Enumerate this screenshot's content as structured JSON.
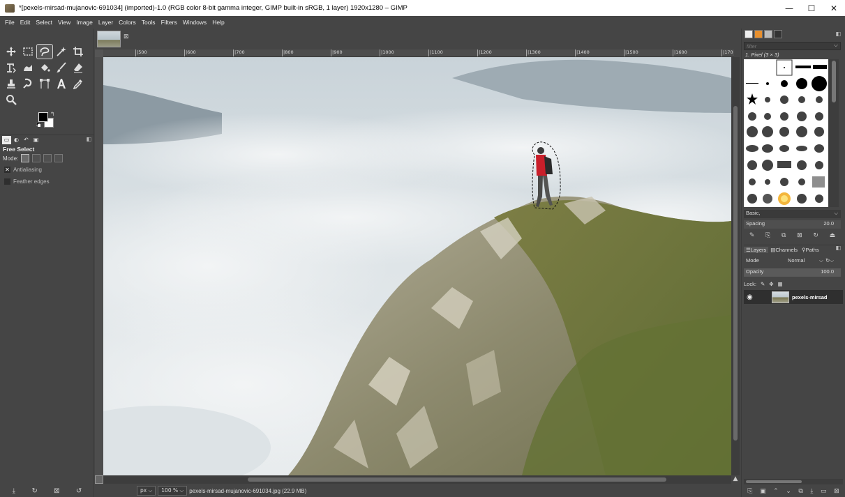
{
  "window": {
    "title": "*[pexels-mirsad-mujanovic-691034] (imported)-1.0 (RGB color 8-bit gamma integer, GIMP built-in sRGB, 1 layer) 1920x1280 – GIMP",
    "minimize": "—",
    "maximize": "☐",
    "close": "✕"
  },
  "menu": [
    "File",
    "Edit",
    "Select",
    "View",
    "Image",
    "Layer",
    "Colors",
    "Tools",
    "Filters",
    "Windows",
    "Help"
  ],
  "tool_options": {
    "title": "Free Select",
    "mode_label": "Mode:",
    "antialiasing": "Antialiasing",
    "feather_edges": "Feather edges",
    "antialiasing_check": "✕"
  },
  "ruler": {
    "ticks": [
      "|500",
      "|600",
      "|700",
      "|800",
      "|900",
      "|1000",
      "|1100",
      "|1200",
      "|1300",
      "|1400",
      "|1500",
      "|1600",
      "|170"
    ]
  },
  "status": {
    "unit": "px",
    "zoom": "100 %",
    "message": "pexels-mirsad-mujanovic-691034.jpg (22.9 MB)"
  },
  "brushes": {
    "filter_placeholder": "filter",
    "current_brush": "1. Pixel (3 × 3)",
    "tag": "Basic,",
    "spacing_label": "Spacing",
    "spacing_value": "20.0"
  },
  "layers": {
    "tabs": [
      "Layers",
      "Channels",
      "Paths"
    ],
    "mode_label": "Mode",
    "mode_value": "Normal",
    "opacity_label": "Opacity",
    "opacity_value": "100.0",
    "lock_label": "Lock:",
    "layer_name": "pexels-mirsad"
  },
  "colors": {
    "fg": "#000000",
    "bg": "#ffffff"
  }
}
